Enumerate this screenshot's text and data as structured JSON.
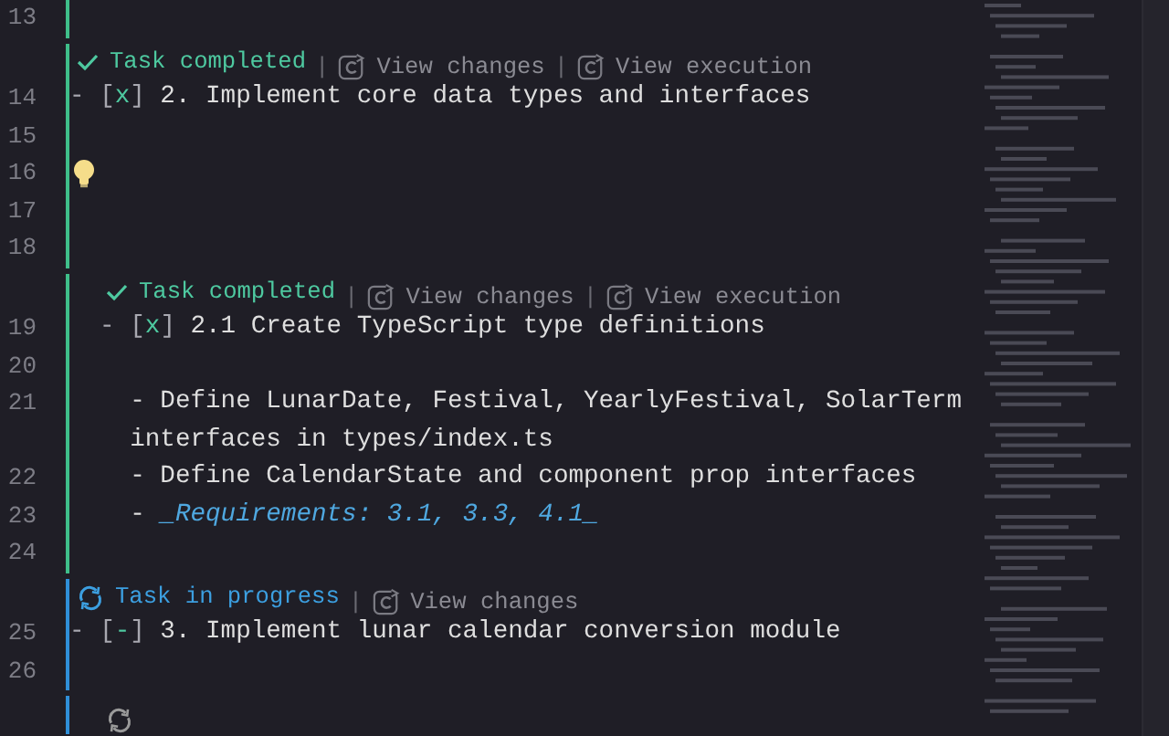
{
  "rows": [
    {
      "kind": "line",
      "number": "13",
      "text": "",
      "color": "#3fbf8a"
    },
    {
      "kind": "codelens",
      "nested": false,
      "status": {
        "kind": "completed",
        "label": "Task completed"
      },
      "actions": [
        {
          "separator": "|",
          "label": "View changes"
        },
        {
          "separator": "|",
          "label": "View execution"
        }
      ],
      "color": "#3fbf8a"
    },
    {
      "kind": "task",
      "number": "14",
      "prefix": "- ",
      "checkbox": "[x]",
      "text": " 2. Implement core data types and interfaces",
      "color": "#3fbf8a"
    },
    {
      "kind": "line",
      "number": "15",
      "text": "",
      "color": "#3fbf8a"
    },
    {
      "kind": "line",
      "number": "16",
      "text": "",
      "bulb": true,
      "color": "#3fbf8a"
    },
    {
      "kind": "line",
      "number": "17",
      "text": "",
      "color": "#3fbf8a"
    },
    {
      "kind": "line",
      "number": "18",
      "text": "",
      "color": "#3fbf8a"
    },
    {
      "kind": "codelens",
      "nested": true,
      "status": {
        "kind": "completed",
        "label": "Task completed"
      },
      "actions": [
        {
          "separator": "|",
          "label": "View changes"
        },
        {
          "separator": "|",
          "label": "View execution"
        }
      ],
      "color": "#3fbf8a"
    },
    {
      "kind": "task",
      "number": "19",
      "prefix": "  - ",
      "checkbox": "[x]",
      "text": " 2.1 Create TypeScript type definitions",
      "color": "#3fbf8a"
    },
    {
      "kind": "line",
      "number": "20",
      "text": "",
      "color": "#3fbf8a"
    },
    {
      "kind": "line",
      "number": "21",
      "text": "    - Define LunarDate, Festival, YearlyFestival, SolarTerm",
      "color": "#3fbf8a"
    },
    {
      "kind": "line",
      "text": "    interfaces in types/index.ts",
      "color": "#3fbf8a"
    },
    {
      "kind": "line",
      "number": "22",
      "text": "    - Define CalendarState and component prop interfaces",
      "color": "#3fbf8a"
    },
    {
      "kind": "note",
      "number": "23",
      "prefix": "    - ",
      "text": "_Requirements: 3.1, 3.3, 4.1_",
      "color": "#3fbf8a"
    },
    {
      "kind": "line",
      "number": "24",
      "text": "",
      "color": "#3fbf8a"
    },
    {
      "kind": "codelens",
      "nested": false,
      "status": {
        "kind": "in_progress",
        "label": "Task in progress"
      },
      "actions": [
        {
          "separator": "|",
          "label": "View changes"
        }
      ],
      "color": "#2f8fd8"
    },
    {
      "kind": "task",
      "number": "25",
      "prefix": "- ",
      "checkbox": "[-]",
      "text": " 3. Implement lunar calendar conversion module",
      "color": "#2f8fd8"
    },
    {
      "kind": "line",
      "number": "26",
      "text": "",
      "color": "#2f8fd8"
    },
    {
      "kind": "codelens",
      "nested": true,
      "status": {
        "kind": "queued"
      },
      "actions": [],
      "color": "#2f8fd8"
    }
  ]
}
